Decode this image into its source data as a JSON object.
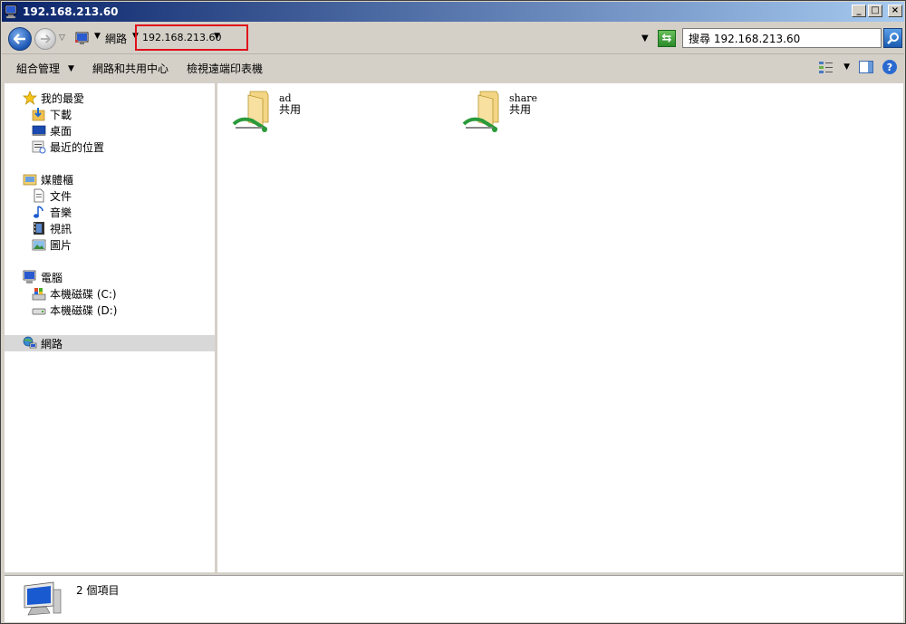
{
  "window": {
    "title": "192.168.213.60",
    "controls": {
      "minimize": "_",
      "maximize": "□",
      "close": "×"
    }
  },
  "address_bar": {
    "breadcrumb": [
      "網路",
      "192.168.213.60"
    ],
    "search_placeholder": "搜尋 192.168.213.60"
  },
  "toolbar": {
    "organize_label": "組合管理",
    "network_center_label": "網路和共用中心",
    "printers_label": "檢視遠端印表機"
  },
  "nav_pane": {
    "favorites": {
      "label": "我的最愛",
      "items": [
        {
          "label": "下載",
          "icon": "download-folder-icon"
        },
        {
          "label": "桌面",
          "icon": "desktop-icon"
        },
        {
          "label": "最近的位置",
          "icon": "recent-places-icon"
        }
      ]
    },
    "libraries": {
      "label": "媒體櫃",
      "items": [
        {
          "label": "文件",
          "icon": "documents-icon"
        },
        {
          "label": "音樂",
          "icon": "music-icon"
        },
        {
          "label": "視訊",
          "icon": "video-icon"
        },
        {
          "label": "圖片",
          "icon": "pictures-icon"
        }
      ]
    },
    "computer": {
      "label": "電腦",
      "items": [
        {
          "label": "本機磁碟 (C:)",
          "icon": "drive-c-icon"
        },
        {
          "label": "本機磁碟 (D:)",
          "icon": "drive-d-icon"
        }
      ]
    },
    "network": {
      "label": "網路",
      "selected": true
    }
  },
  "content": {
    "shares": [
      {
        "name": "ad",
        "type": "共用"
      },
      {
        "name": "share",
        "type": "共用"
      }
    ]
  },
  "details": {
    "item_count": "2 個項目"
  },
  "colors": {
    "highlight_border": "#e0101a",
    "title_bar": "#0a246a",
    "selection": "#d8d8d8"
  }
}
